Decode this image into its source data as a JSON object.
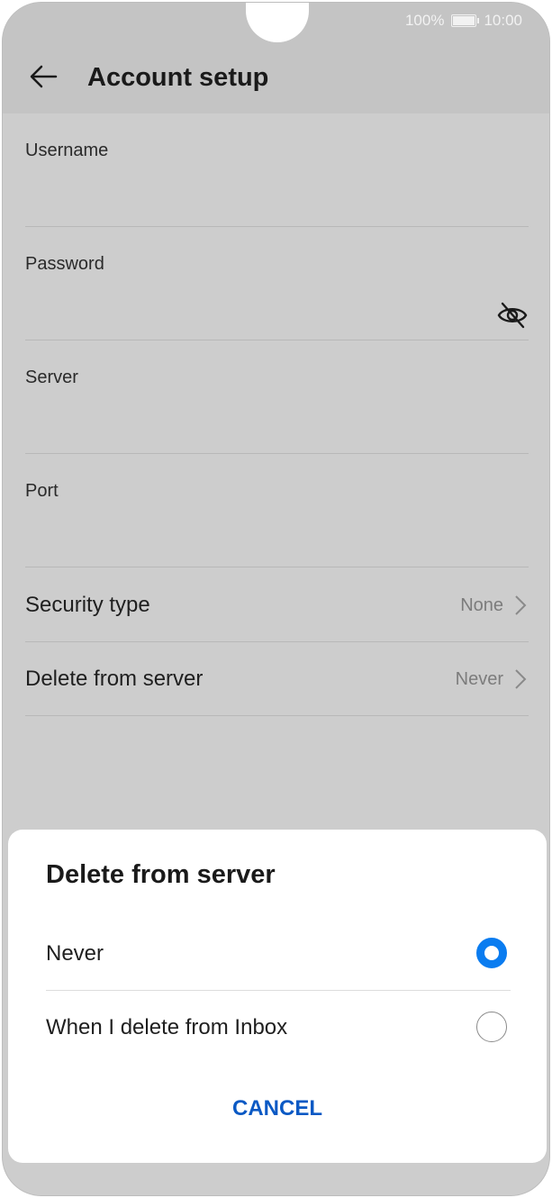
{
  "status_bar": {
    "battery": "100%",
    "time": "10:00"
  },
  "header": {
    "title": "Account setup",
    "back_icon": "arrow-left-icon"
  },
  "form": {
    "fields": [
      {
        "label": "Username"
      },
      {
        "label": "Password",
        "icon": "eye-off-icon"
      },
      {
        "label": "Server"
      },
      {
        "label": "Port"
      }
    ],
    "rows": [
      {
        "label": "Security type",
        "value": "None"
      },
      {
        "label": "Delete from server",
        "value": "Never"
      }
    ]
  },
  "dialog": {
    "title": "Delete from server",
    "options": [
      {
        "label": "Never",
        "selected": true
      },
      {
        "label": "When I delete from Inbox",
        "selected": false
      }
    ],
    "cancel_label": "CANCEL"
  },
  "colors": {
    "accent": "#0a7cf0",
    "cancel": "#0a59c4",
    "scrim": "#cdcdcd"
  }
}
